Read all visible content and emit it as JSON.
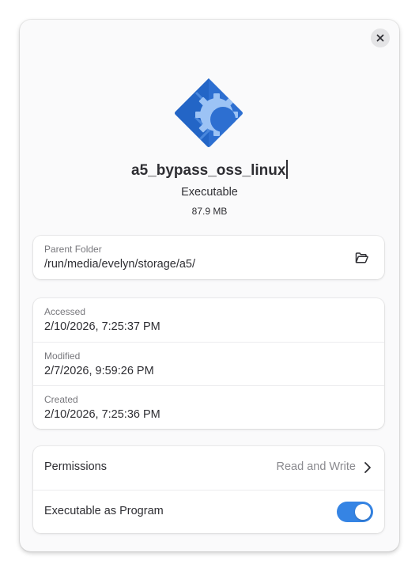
{
  "dialog": {
    "file_name": "a5_bypass_oss_linux",
    "file_type": "Executable",
    "file_size": "87.9 MB",
    "icon": "application-x-executable-icon",
    "close_icon": "close-icon"
  },
  "location": {
    "label": "Parent Folder",
    "value": "/run/media/evelyn/storage/a5/",
    "button_icon": "open-folder-icon"
  },
  "dates": [
    {
      "label": "Accessed",
      "value": "2/10/2026, 7:25:37 PM"
    },
    {
      "label": "Modified",
      "value": "2/7/2026, 9:59:26 PM"
    },
    {
      "label": "Created",
      "value": "2/10/2026, 7:25:36 PM"
    }
  ],
  "permissions": {
    "label": "Permissions",
    "value": "Read and Write",
    "executable_label": "Executable as Program",
    "executable_enabled": true
  },
  "colors": {
    "accent": "#3584e4",
    "window_bg": "#fafafb",
    "card_bg": "#ffffff",
    "text": "#2e2e33",
    "dim_text": "#77777c"
  }
}
